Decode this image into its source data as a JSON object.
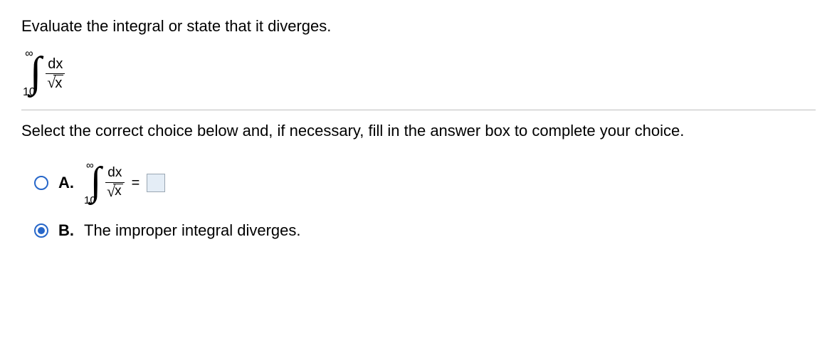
{
  "question": {
    "prompt": "Evaluate the integral or state that it diverges.",
    "integral": {
      "upper": "∞",
      "lower": "10",
      "numerator": "dx",
      "radical_symbol": "√",
      "radicand": "x"
    }
  },
  "instruction": "Select the correct choice below and, if necessary, fill in the answer box to complete your choice.",
  "choices": {
    "a": {
      "label": "A.",
      "integral": {
        "upper": "∞",
        "lower": "10",
        "numerator": "dx",
        "radical_symbol": "√",
        "radicand": "x"
      },
      "equals": "=",
      "answer": ""
    },
    "b": {
      "label": "B.",
      "text": "The improper integral diverges."
    }
  },
  "selected_choice": "b"
}
